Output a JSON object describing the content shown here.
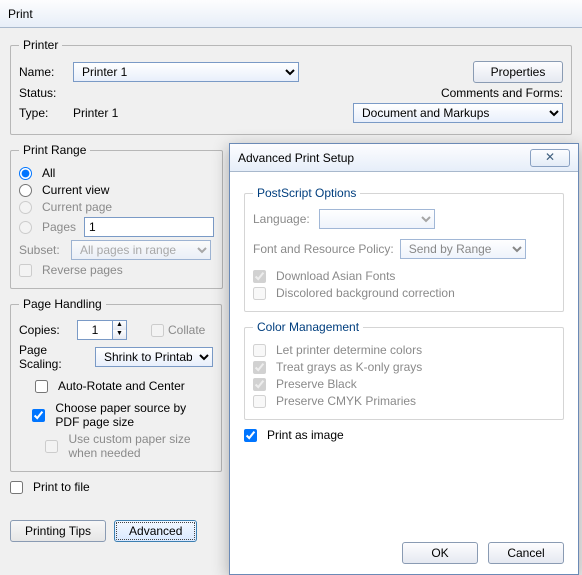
{
  "title": "Print",
  "printer": {
    "group": "Printer",
    "nameLabel": "Name:",
    "name": "Printer 1",
    "statusLabel": "Status:",
    "typeLabel": "Type:",
    "type": "Printer 1",
    "propertiesBtn": "Properties",
    "commentsLabel": "Comments and Forms:",
    "comments": "Document and Markups"
  },
  "range": {
    "group": "Print Range",
    "all": "All",
    "currentView": "Current view",
    "currentPage": "Current page",
    "pages": "Pages",
    "pagesValue": "1",
    "subsetLabel": "Subset:",
    "subset": "All pages in range",
    "reverse": "Reverse pages"
  },
  "handling": {
    "group": "Page Handling",
    "copiesLabel": "Copies:",
    "copies": "1",
    "collate": "Collate",
    "scalingLabel": "Page Scaling:",
    "scaling": "Shrink to Printable Area",
    "autorotate": "Auto-Rotate and Center",
    "choosepaper": "Choose paper source by PDF page size",
    "custompaper": "Use custom paper size when needed"
  },
  "printToFile": "Print to file",
  "tipsBtn": "Printing Tips",
  "advancedBtn": "Advanced",
  "adv": {
    "title": "Advanced Print Setup",
    "ps": {
      "group": "PostScript Options",
      "languageLabel": "Language:",
      "policyLabel": "Font and Resource Policy:",
      "policy": "Send by Range",
      "downloadAsian": "Download Asian Fonts",
      "discolored": "Discolored background correction"
    },
    "color": {
      "group": "Color Management",
      "letPrinter": "Let printer determine colors",
      "treatGrays": "Treat grays as K-only grays",
      "preserveBlack": "Preserve Black",
      "preserveCMYK": "Preserve CMYK Primaries"
    },
    "printAsImage": "Print as image",
    "ok": "OK",
    "cancel": "Cancel"
  }
}
